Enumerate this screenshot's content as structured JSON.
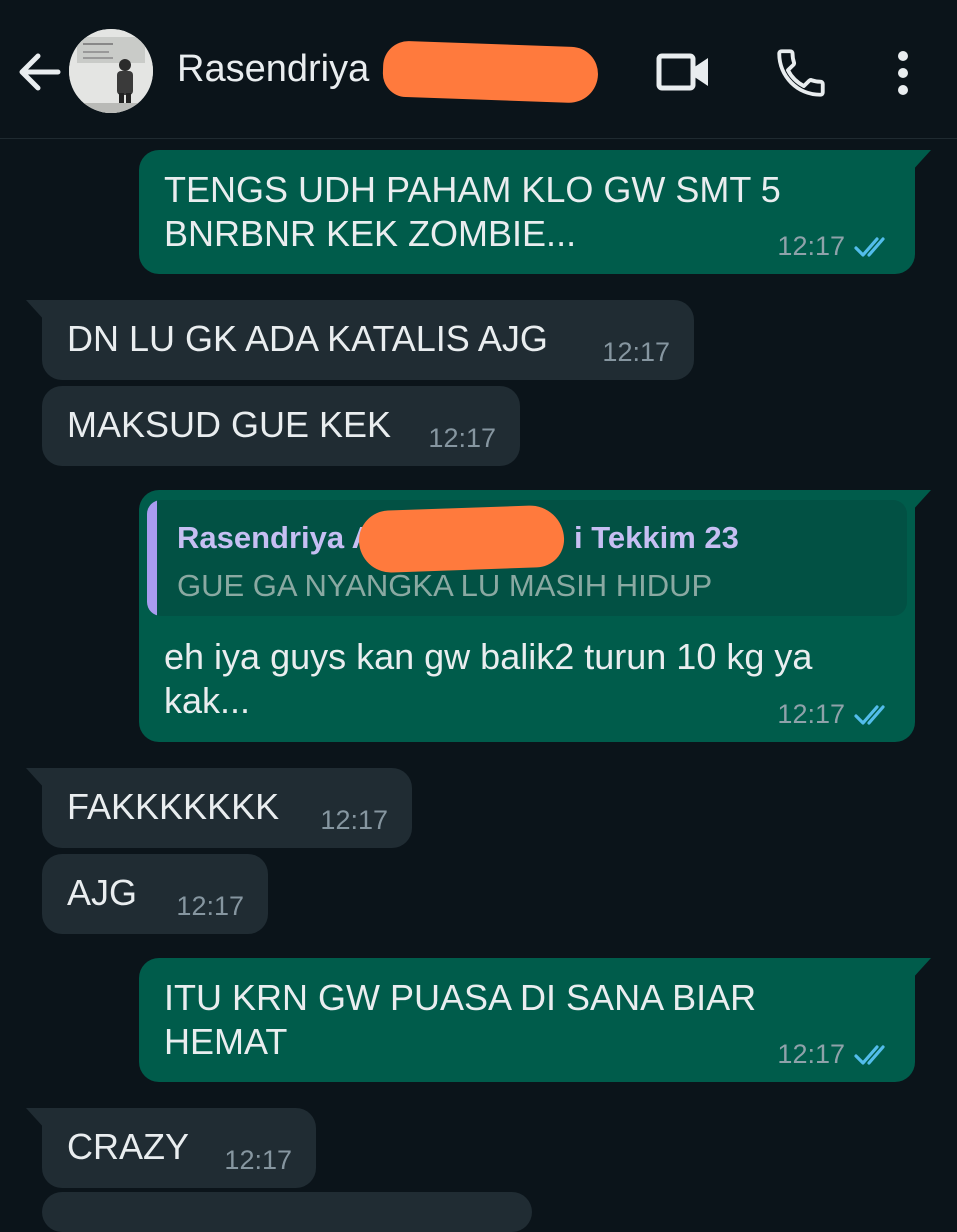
{
  "header": {
    "contact_name": "Rasendriya",
    "icons": [
      "back-arrow-icon",
      "video-call-icon",
      "phone-call-icon",
      "more-options-icon"
    ]
  },
  "messages": [
    {
      "direction": "outgoing",
      "text": "TENGS UDH PAHAM KLO GW SMT 5\nBNRBNR KEK ZOMBIE...",
      "time": "12:17",
      "status": "read"
    },
    {
      "direction": "incoming",
      "text": "DN LU GK ADA KATALIS AJG",
      "time": "12:17"
    },
    {
      "direction": "incoming",
      "text": "MAKSUD GUE KEK",
      "time": "12:17"
    },
    {
      "direction": "outgoing",
      "quote": {
        "author_start": "Rasendriya A",
        "author_end": "i Tekkim 23",
        "text": "GUE GA NYANGKA LU MASIH HIDUP"
      },
      "text": "eh iya guys kan gw balik2 turun 10 kg ya\nkak...",
      "time": "12:17",
      "status": "read"
    },
    {
      "direction": "incoming",
      "text": "FAKKKKKKK",
      "time": "12:17"
    },
    {
      "direction": "incoming",
      "text": "AJG",
      "time": "12:17"
    },
    {
      "direction": "outgoing",
      "text": "ITU KRN GW PUASA DI SANA BIAR\nHEMAT",
      "time": "12:17",
      "status": "read"
    },
    {
      "direction": "incoming",
      "text": "CRAZY",
      "time": "12:17"
    }
  ],
  "colors": {
    "background": "#0b141a",
    "outgoing_bubble": "#005c4b",
    "incoming_bubble": "#202c33",
    "read_check": "#53bdeb",
    "redaction": "#ff7a3d"
  }
}
